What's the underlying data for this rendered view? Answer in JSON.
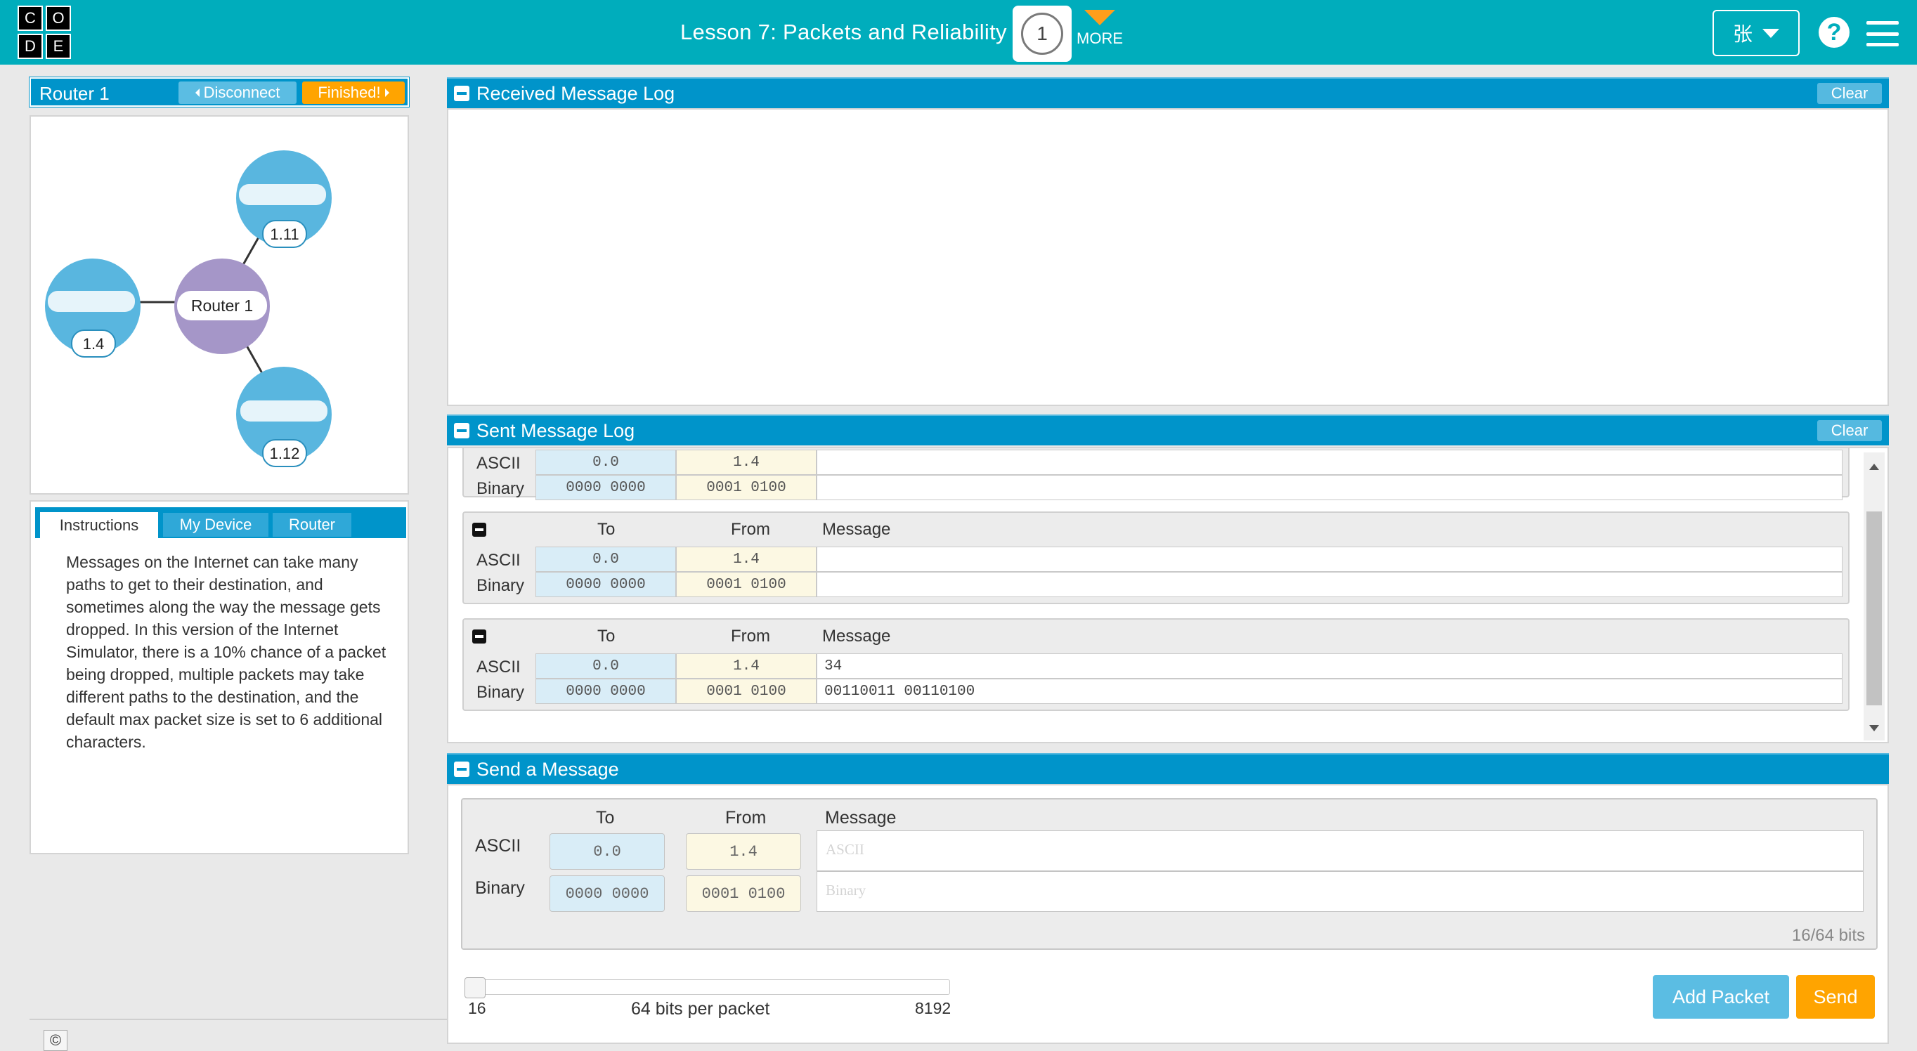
{
  "header": {
    "logo_letters": [
      "C",
      "O",
      "D",
      "E"
    ],
    "lesson_title": "Lesson 7: Packets and Reliability",
    "level_number": "1",
    "more_label": "MORE",
    "user_label": "张",
    "colors": {
      "bar": "#00adbc",
      "accent": "#ff9e1b"
    }
  },
  "router_panel": {
    "title": "Router 1",
    "disconnect_label": "Disconnect",
    "finished_label": "Finished!"
  },
  "network": {
    "router_label": "Router 1",
    "nodes": [
      {
        "address": "1.11"
      },
      {
        "address": "1.4"
      },
      {
        "address": "1.12"
      }
    ],
    "colors": {
      "node": "#59b6df",
      "router": "#a596c8"
    }
  },
  "tabs": {
    "items": [
      "Instructions",
      "My Device",
      "Router"
    ],
    "active": "Instructions",
    "instructions_text": "Messages on the Internet can take many paths to get to their destination, and sometimes along the way the message gets dropped. In this version of the Internet Simulator, there is a 10% chance of a packet being dropped, multiple packets may take different paths to the destination, and the default max packet size is set to 6 additional characters."
  },
  "received_log": {
    "title": "Received Message Log",
    "clear_label": "Clear"
  },
  "sent_log": {
    "title": "Sent Message Log",
    "clear_label": "Clear",
    "columns": {
      "to": "To",
      "from": "From",
      "message": "Message"
    },
    "row_labels": {
      "ascii": "ASCII",
      "binary": "Binary"
    },
    "packets": [
      {
        "to_ascii": "0.0",
        "to_binary": "0000 0000",
        "from_ascii": "1.4",
        "from_binary": "0001 0100",
        "msg_ascii": "",
        "msg_binary": ""
      },
      {
        "to_ascii": "0.0",
        "to_binary": "0000 0000",
        "from_ascii": "1.4",
        "from_binary": "0001 0100",
        "msg_ascii": "",
        "msg_binary": ""
      },
      {
        "to_ascii": "0.0",
        "to_binary": "0000 0000",
        "from_ascii": "1.4",
        "from_binary": "0001 0100",
        "msg_ascii": "34",
        "msg_binary": "00110011 00110100"
      }
    ]
  },
  "send_message": {
    "title": "Send a Message",
    "columns": {
      "to": "To",
      "from": "From",
      "message": "Message"
    },
    "row_labels": {
      "ascii": "ASCII",
      "binary": "Binary"
    },
    "to_ascii": "0.0",
    "to_binary": "0000 0000",
    "from_ascii": "1.4",
    "from_binary": "0001 0100",
    "msg_ascii_placeholder": "ASCII",
    "msg_binary_placeholder": "Binary",
    "bits_count": "16/64 bits",
    "slider": {
      "min": "16",
      "max": "8192",
      "label": "64 bits per packet",
      "value": 64
    },
    "add_packet_label": "Add Packet",
    "send_label": "Send"
  },
  "footer": {
    "copyright_symbol": "©"
  }
}
